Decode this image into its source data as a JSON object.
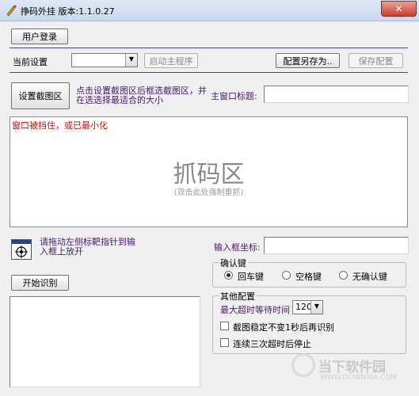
{
  "window": {
    "title": "挣码外挂 版本:1.1.0.27",
    "close_glyph": "✕"
  },
  "buttons": {
    "user_login": "用户登录",
    "launch_main": "启动主程序",
    "save_config_as": "配置另存为..",
    "save_config": "保存配置",
    "set_capture": "设置截图区",
    "start_recognize": "开始识别"
  },
  "labels": {
    "current_config": "当前设置",
    "capture_hint": "点击设置截图区后框选截图区，并在选选择最适合的大小",
    "main_window_title": "主窗口标题:",
    "window_blocked": "窗口被挡住，或已最小化",
    "drag_hint": "请拖动左侧标靶指针到输入框上放开",
    "input_coords": "输入框坐标:"
  },
  "capture_area": {
    "title": "抓码区",
    "subtitle": "(双击此处强制重抓)"
  },
  "confirm_group": {
    "title": "确认键",
    "options": [
      "回车键",
      "空格键",
      "无确认键"
    ],
    "selected": 0
  },
  "other_group": {
    "title": "其他配置",
    "max_timeout_label": "最大超时等待时间",
    "max_timeout_value": "120",
    "stable_label": "截图稳定不变1秒后再识别",
    "stop_label": "连续三次超时后停止"
  },
  "watermark": {
    "text": "当下软件园",
    "url": "WWW.DOWNXIA.COM"
  },
  "colors": {
    "accent_line": "#4b4b9c",
    "hint_purple": "#4a1b6b",
    "warning_red": "#e00000"
  }
}
